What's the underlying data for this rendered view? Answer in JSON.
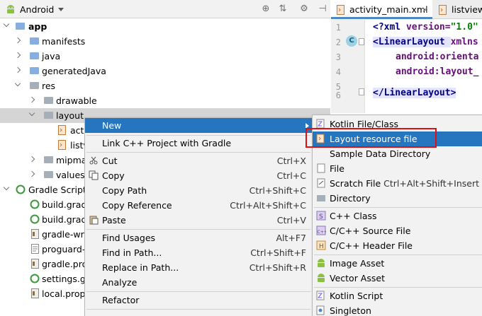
{
  "project_panel": {
    "title": "Android",
    "tree": [
      {
        "label": "app"
      },
      {
        "label": "manifests"
      },
      {
        "label": "java"
      },
      {
        "label": "generatedJava"
      },
      {
        "label": "res"
      },
      {
        "label": "drawable"
      },
      {
        "label": "layout"
      },
      {
        "label": "acti"
      },
      {
        "label": "listv"
      },
      {
        "label": "mipmap"
      },
      {
        "label": "values"
      },
      {
        "label": "Gradle Scripts"
      },
      {
        "label": "build.gradle"
      },
      {
        "label": "build.gradle"
      },
      {
        "label": "gradle-wrap"
      },
      {
        "label": "proguard-ru"
      },
      {
        "label": "gradle.prop"
      },
      {
        "label": "settings.gra"
      },
      {
        "label": "local.prope"
      }
    ]
  },
  "editor": {
    "tabs": [
      {
        "label": "activity_main.xml",
        "close": "×"
      },
      {
        "label": "listview_"
      }
    ],
    "line_numbers": [
      "1",
      "2",
      "3",
      "4",
      "5",
      "6"
    ],
    "code": {
      "l1a": "<?xml ",
      "l1b": "version=",
      "l1c": "\"1.0\"",
      "l2a": "<LinearLayout ",
      "l2b": "xmlns",
      "l3": "android:orienta",
      "l4": "android:layout_",
      "l6": "</LinearLayout>"
    },
    "gutter_badge": "C"
  },
  "context_menu": {
    "items": [
      {
        "label": "New",
        "shortcut": ""
      },
      {
        "label": "Link C++ Project with Gradle",
        "shortcut": ""
      },
      {
        "label": "Cut",
        "shortcut": "Ctrl+X"
      },
      {
        "label": "Copy",
        "shortcut": "Ctrl+C"
      },
      {
        "label": "Copy Path",
        "shortcut": "Ctrl+Shift+C"
      },
      {
        "label": "Copy Reference",
        "shortcut": "Ctrl+Alt+Shift+C"
      },
      {
        "label": "Paste",
        "shortcut": "Ctrl+V"
      },
      {
        "label": "Find Usages",
        "shortcut": "Alt+F7"
      },
      {
        "label": "Find in Path...",
        "shortcut": "Ctrl+Shift+F"
      },
      {
        "label": "Replace in Path...",
        "shortcut": "Ctrl+Shift+R"
      },
      {
        "label": "Analyze",
        "shortcut": ""
      },
      {
        "label": "Refactor",
        "shortcut": ""
      }
    ]
  },
  "new_submenu": {
    "items": [
      {
        "label": "Kotlin File/Class",
        "shortcut": ""
      },
      {
        "label": "Layout resource file",
        "shortcut": ""
      },
      {
        "label": "Sample Data Directory",
        "shortcut": ""
      },
      {
        "label": "File",
        "shortcut": ""
      },
      {
        "label": "Scratch File",
        "shortcut": "Ctrl+Alt+Shift+Insert"
      },
      {
        "label": "Directory",
        "shortcut": ""
      },
      {
        "label": "C++ Class",
        "shortcut": ""
      },
      {
        "label": "C/C++ Source File",
        "shortcut": ""
      },
      {
        "label": "C/C++ Header File",
        "shortcut": ""
      },
      {
        "label": "Image Asset",
        "shortcut": ""
      },
      {
        "label": "Vector Asset",
        "shortcut": ""
      },
      {
        "label": "Kotlin Script",
        "shortcut": ""
      },
      {
        "label": "Singleton",
        "shortcut": ""
      }
    ]
  },
  "colors": {
    "menu_highlight": "#2675bf",
    "annotation_box": "#e01010",
    "android_green": "#8cc043",
    "folder_blue": "#87aede"
  }
}
